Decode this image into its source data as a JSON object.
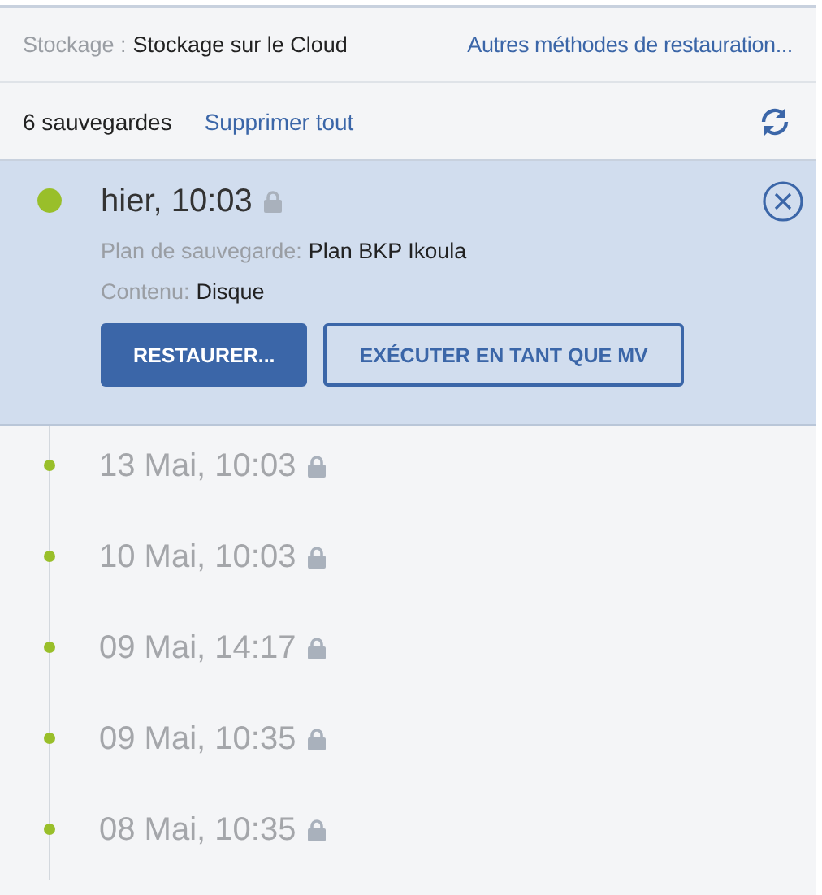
{
  "storage": {
    "label": "Stockage :",
    "value": "Stockage sur le Cloud",
    "link": "Autres méthodes de restauration..."
  },
  "toolbar": {
    "count": "6 sauvegardes",
    "delete_all": "Supprimer tout"
  },
  "backups": [
    {
      "time": "hier, 10:03",
      "locked": true,
      "selected": true,
      "details": [
        {
          "label": "Plan de sauvegarde:",
          "value": "Plan BKP Ikoula"
        },
        {
          "label": "Contenu:",
          "value": "Disque"
        }
      ],
      "buttons": [
        {
          "label": "RESTAURER...",
          "kind": "primary"
        },
        {
          "label": "EXÉCUTER EN TANT QUE MV",
          "kind": "secondary"
        }
      ]
    },
    {
      "time": "13 Mai, 10:03",
      "locked": true,
      "selected": false
    },
    {
      "time": "10 Mai, 10:03",
      "locked": true,
      "selected": false
    },
    {
      "time": "09 Mai, 14:17",
      "locked": true,
      "selected": false
    },
    {
      "time": "09 Mai, 10:35",
      "locked": true,
      "selected": false
    },
    {
      "time": "08 Mai, 10:35",
      "locked": true,
      "selected": false
    }
  ]
}
